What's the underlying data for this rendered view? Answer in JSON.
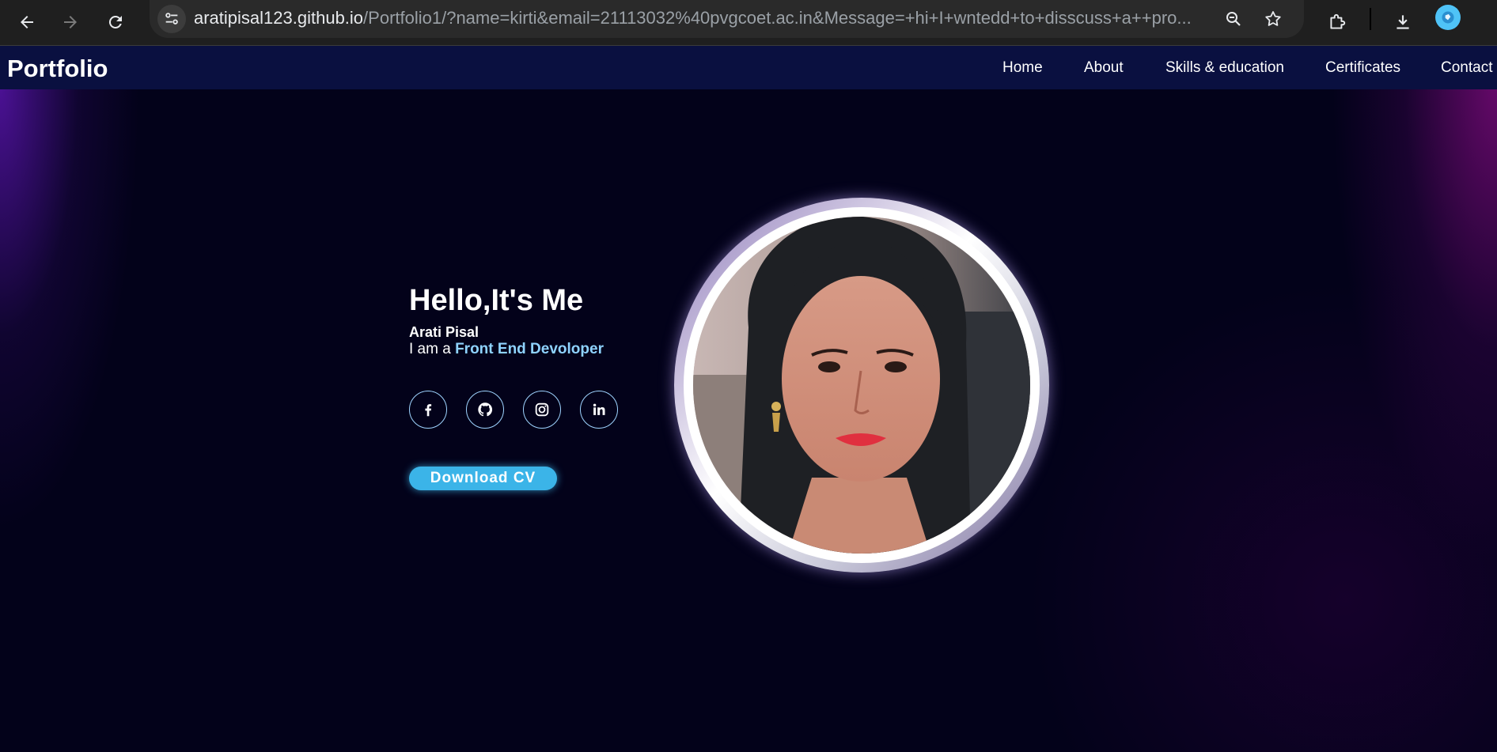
{
  "browser": {
    "url_host": "aratipisal123.github.io",
    "url_path": "/Portfolio1/?name=kirti&email=21113032%40pvgcoet.ac.in&Message=+hi+I+wntedd+to+disscuss+a++pro...",
    "icons": [
      "back-arrow-icon",
      "forward-arrow-icon",
      "reload-icon",
      "site-info-icon",
      "zoom-icon",
      "star-icon",
      "extensions-icon",
      "download-icon",
      "profile-icon"
    ]
  },
  "navbar": {
    "brand": "Portfolio",
    "links": [
      "Home",
      "About",
      "Skills & education",
      "Certificates",
      "Contact"
    ]
  },
  "hero": {
    "greeting": "Hello,It's Me",
    "name": "Arati Pisal",
    "role_prefix": "I am a ",
    "role": "Front End Devoloper",
    "download_label": "Download CV",
    "social": [
      "facebook-icon",
      "github-icon",
      "instagram-icon",
      "linkedin-icon"
    ]
  },
  "colors": {
    "accent": "#3bb4e8",
    "role_text": "#8fd3ff",
    "navbar_bg": "#0a1040",
    "page_bg": "#03021a"
  }
}
